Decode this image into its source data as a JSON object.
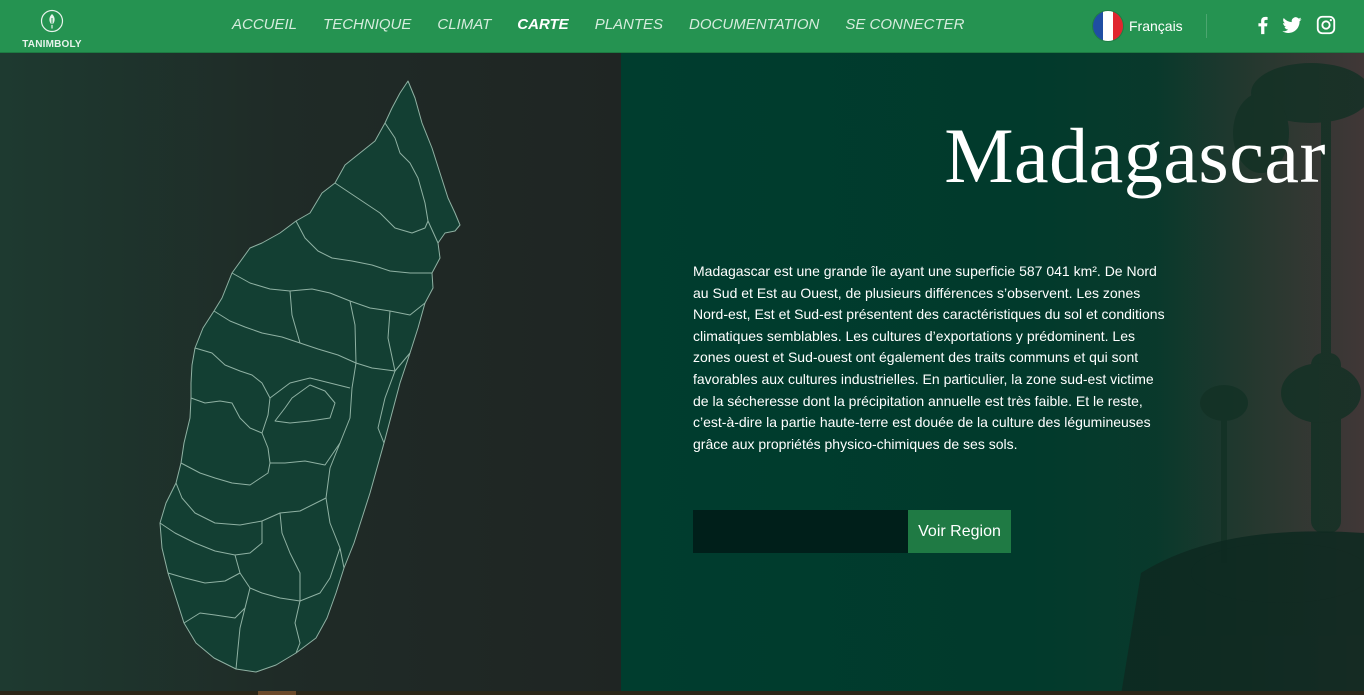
{
  "brand": {
    "name": "TANIMBOLY",
    "icon": "leaf-logo-icon"
  },
  "nav": {
    "items": [
      {
        "label": "ACCUEIL",
        "active": false
      },
      {
        "label": "TECHNIQUE",
        "active": false
      },
      {
        "label": "CLIMAT",
        "active": false
      },
      {
        "label": "CARTE",
        "active": true
      },
      {
        "label": "PLANTES",
        "active": false
      },
      {
        "label": "DOCUMENTATION",
        "active": false
      },
      {
        "label": "SE CONNECTER",
        "active": false
      }
    ],
    "language": {
      "label": "Français",
      "flag_icon": "france-flag-icon"
    },
    "social": [
      "facebook-icon",
      "twitter-icon",
      "instagram-icon"
    ]
  },
  "main": {
    "title": "Madagascar",
    "description": "Madagascar est une grande île ayant une superficie 587 041 km². De Nord au Sud et Est au Ouest, de plusieurs différences s’observent. Les zones Nord-est, Est et Sud-est présentent des caractéristiques du sol et conditions climatiques semblables. Les cultures d’exportations y prédominent. Les zones ouest et Sud-ouest ont également des traits communs et qui sont favorables aux cultures industrielles. En particulier, la zone sud-est victime de la sécheresse dont la précipitation annuelle est très faible. Et le reste, c’est-à-dire la partie haute-terre est douée de la culture des légumineuses grâce aux propriétés physico-chimiques de ses sols.",
    "region_input": {
      "value": "",
      "placeholder": ""
    },
    "button_label": "Voir Region"
  },
  "colors": {
    "nav_bg": "#259351",
    "map_fill": "#133f33",
    "map_stroke": "#8fb1a3",
    "info_bg": "#003d2e",
    "button_bg": "#1f7a44",
    "input_bg": "#001f1a"
  }
}
